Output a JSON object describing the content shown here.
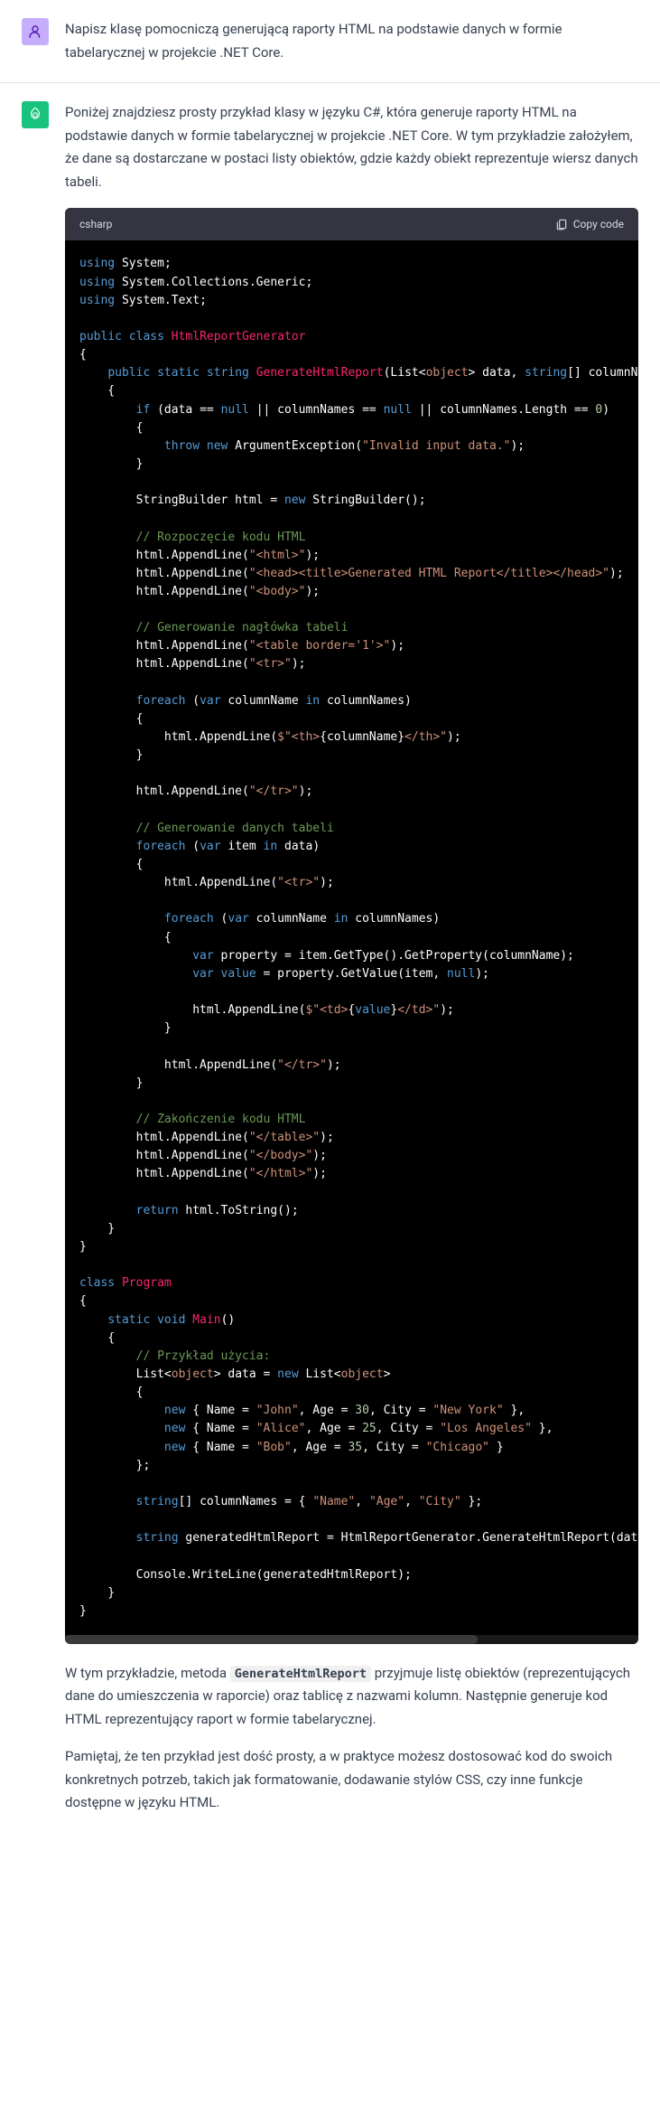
{
  "user_message": "Napisz klasę pomocniczą generującą raporty HTML na podstawie danych w formie tabelarycznej w projekcie .NET Core.",
  "assistant_intro": "Poniżej znajdziesz prosty przykład klasy w języku C#, która generuje raporty HTML na podstawie danych w formie tabelarycznej w projekcie .NET Core. W tym przykładzie założyłem, że dane są dostarczane w postaci listy obiektów, gdzie każdy obiekt reprezentuje wiersz danych tabeli.",
  "code_lang": "csharp",
  "copy_label": "Copy code",
  "assistant_outro_1_pre": "W tym przykładzie, metoda ",
  "assistant_outro_1_code": "GenerateHtmlReport",
  "assistant_outro_1_post": " przyjmuje listę obiektów (reprezentujących dane do umieszczenia w raporcie) oraz tablicę z nazwami kolumn. Następnie generuje kod HTML reprezentujący raport w formie tabelarycznej.",
  "assistant_outro_2": "Pamiętaj, że ten przykład jest dość prosty, a w praktyce możesz dostosować kod do swoich konkretnych potrzeb, takich jak formatowanie, dodawanie stylów CSS, czy inne funkcje dostępne w języku HTML.",
  "code": {
    "lines_raw": "see markup"
  }
}
